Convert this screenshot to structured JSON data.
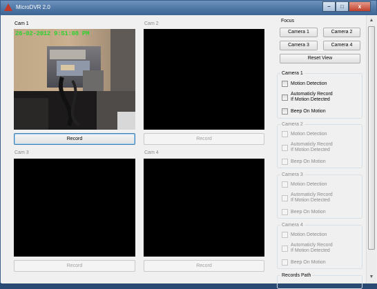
{
  "window": {
    "title": "MicroDVR 2.0",
    "minimize_glyph": "–",
    "maximize_glyph": "□",
    "close_glyph": "x"
  },
  "cameras": [
    {
      "label": "Cam 1",
      "record_label": "Record",
      "overlay": "26-02-2012 9:51:08 PM",
      "enabled": true
    },
    {
      "label": "Cam 2",
      "record_label": "Record",
      "enabled": false
    },
    {
      "label": "Cam 3",
      "record_label": "Record",
      "enabled": false
    },
    {
      "label": "Cam 4",
      "record_label": "Record",
      "enabled": false
    }
  ],
  "focus": {
    "title": "Focus",
    "buttons": [
      "Camera 1",
      "Camera 2",
      "Camera 3",
      "Camera 4"
    ],
    "reset_label": "Reset View"
  },
  "camera_settings": [
    {
      "title": "Camera 1",
      "motion": "Motion Detection",
      "auto_record": "Automaticly Record",
      "auto_record_2": "If Motion Detected",
      "beep": "Beep On Motion"
    },
    {
      "title": "Camera 2",
      "motion": "Motion Detection",
      "auto_record": "Automaticly Record",
      "auto_record_2": "If Motion Detected",
      "beep": "Beep On Motion"
    },
    {
      "title": "Camera 3",
      "motion": "Motion Detection",
      "auto_record": "Automaticly Record",
      "auto_record_2": "If Motion Detected",
      "beep": "Beep On Motion"
    },
    {
      "title": "Camera 4",
      "motion": "Motion Detection",
      "auto_record": "Automaticly Record",
      "auto_record_2": "If Motion Detected",
      "beep": "Beep On Motion"
    }
  ],
  "records_path": {
    "title": "Records Path"
  },
  "scrollbar": {
    "up_glyph": "▲",
    "down_glyph": "▼"
  },
  "colors": {
    "overlay_text": "#2fd12f",
    "titlebar": "#4f77a6",
    "feed_background": "#000000"
  }
}
